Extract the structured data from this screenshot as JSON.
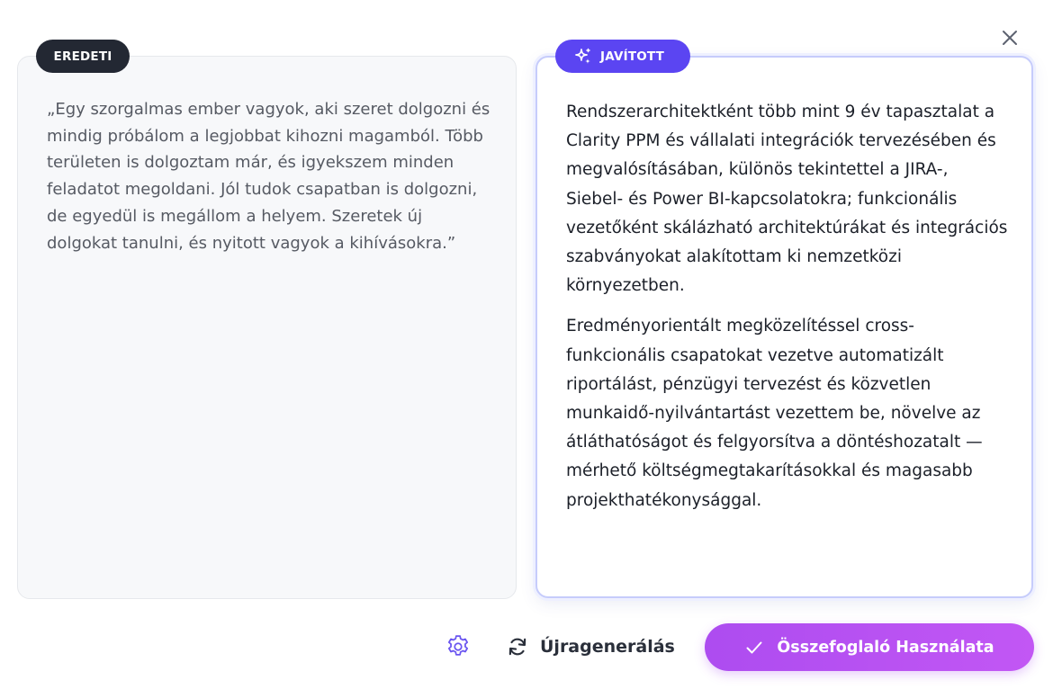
{
  "dialog": {
    "close_icon": "close-icon",
    "accent_color": "#5b45f2",
    "action_color": "#b650f2"
  },
  "original": {
    "badge_label": "EREDETI",
    "text": "„Egy szorgalmas ember vagyok, aki szeret dolgozni és mindig próbálom a legjobbat kihozni magamból. Több területen is dolgoztam már, és igyekszem minden feladatot megoldani. Jól tudok csapatban is dolgozni, de egyedül is megállom a helyem. Szeretek új dolgokat tanulni, és nyitott vagyok a kihívásokra.”"
  },
  "improved": {
    "badge_label": "JAVÍTOTT",
    "badge_icon": "sparkles-icon",
    "paragraphs": [
      "Rendszerarchitektként több mint 9 év tapasztalat a Clarity PPM és vállalati integrációk tervezésében és megvalósításában, különös tekintettel a JIRA-, Siebel- és Power BI-kapcsolatokra; funkcionális vezetőként skálázható architektúrákat és integrációs szabványokat alakítottam ki nemzetközi környezetben.",
      "Eredményorientált megközelítéssel cross-funkcionális csapatokat vezetve automatizált riportálást, pénzügyi tervezést és közvetlen munkaidő-nyilvántartást vezettem be, növelve az átláthatóságot és felgyorsítva a döntéshozatalt — mérhető költségmegtakarításokkal és magasabb projekthatékonysággal."
    ]
  },
  "footer": {
    "settings_icon": "gear-icon",
    "regenerate_icon": "refresh-icon",
    "regenerate_label": "Újragenerálás",
    "use_icon": "check-icon",
    "use_label": "Összefoglaló Használata"
  }
}
